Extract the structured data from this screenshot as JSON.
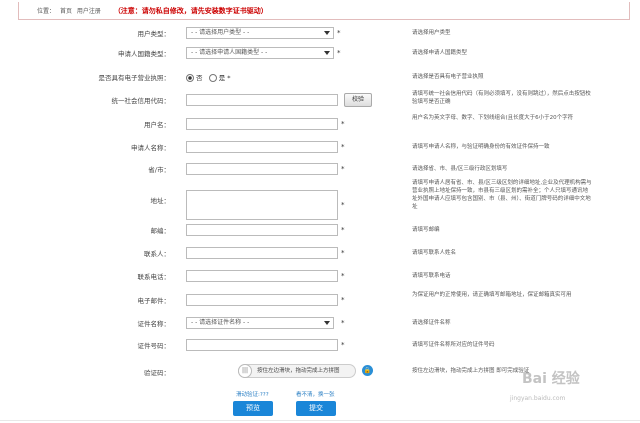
{
  "breadcrumb": {
    "location_label": "位置：",
    "home": "首页",
    "current": "用户注册",
    "notice": "（注意：请勿私自修改，请先安装数字证书驱动）"
  },
  "form": {
    "user_type": {
      "label": "用户类型：",
      "value": "- - 请选择用户类型 - -",
      "hint": "请选择用户类型"
    },
    "applicant_type": {
      "label": "申请人国籍类型：",
      "value": "- - 请选择申请人国籍类型 - -",
      "hint": "请选择申请人国籍类型"
    },
    "business_license": {
      "label": "是否具有电子营业执照：",
      "options": [
        "否",
        "是"
      ],
      "selected": "否",
      "hint": "请选择是否具有电子营业执照"
    },
    "credit_code": {
      "label": "统一社会信用代码：",
      "button": "校验",
      "hint": "请填写统一社会信用代码（有则必须填写，没有则跳过），然后点击按钮校验填写是否正确"
    },
    "username": {
      "label": "用户名：",
      "hint": "用户名为英文字母、数字、下划线组合(且长度大于6小于20个字符"
    },
    "applicant_name": {
      "label": "申请人名称：",
      "hint": "请填写申请人名称，与验证明确身份的有效证件保持一致"
    },
    "province_city": {
      "label": "省/市：",
      "hint": "请选择省、市、县/区三级行政区划填写"
    },
    "address": {
      "label": "地址：",
      "hint": "请填写申请人居有省、市、县/区三级区划的详细地址,企业及代理机构需与营业执照上地址保持一致，市县有三级区划的需补全；个人只填写通讯地址外国申请人应填写包含国别、市（县、州）、街道门牌号码的详细中文地址"
    },
    "postcode": {
      "label": "邮编：",
      "hint": "请填写邮编"
    },
    "contact": {
      "label": "联系人：",
      "hint": "请填写联系人姓名"
    },
    "phone": {
      "label": "联系电话：",
      "hint": "请填写联系电话"
    },
    "email": {
      "label": "电子邮件：",
      "hint": "为保证用户的正常使用，请正确填写邮箱地址，保证邮箱真实可用"
    },
    "cert_name": {
      "label": "证件名称：",
      "value": "- - 请选择证件名称 - -",
      "hint": "请选择证件名称"
    },
    "cert_number": {
      "label": "证件号码：",
      "hint": "请填写证件名称所对应的证件号码"
    },
    "captcha": {
      "label": "验证码：",
      "slider_text": "按住左边滑块，拖动完成上方拼图",
      "hint": "按住左边滑块，拖动完成上方拼图",
      "hint_tail": "即可完成验证",
      "status_left": "滑动验证:???",
      "status_right": "看不清，换一张"
    }
  },
  "required_mark": "*",
  "buttons": {
    "preview": "预览",
    "submit": "提交"
  },
  "watermark": {
    "logo": "Bai 经验",
    "url": "jingyan.baidu.com"
  },
  "colors": {
    "accent": "#1a86d8",
    "notice": "#cc0000"
  }
}
